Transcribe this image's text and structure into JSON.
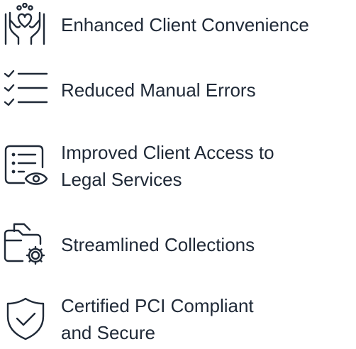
{
  "items": [
    {
      "icon": "hands-heart-icon",
      "lines": [
        "Enhanced Client Convenience"
      ]
    },
    {
      "icon": "checklist-icon",
      "lines": [
        "Reduced Manual Errors"
      ]
    },
    {
      "icon": "list-eye-icon",
      "lines": [
        "Improved Client Access to",
        "Legal Services"
      ]
    },
    {
      "icon": "folder-gear-icon",
      "lines": [
        "Streamlined Collections"
      ]
    },
    {
      "icon": "shield-check-icon",
      "lines": [
        "Certified PCI Compliant",
        "and Secure"
      ]
    }
  ],
  "colors": {
    "text": "#1f2937",
    "icon_stroke": "#1f2937"
  }
}
